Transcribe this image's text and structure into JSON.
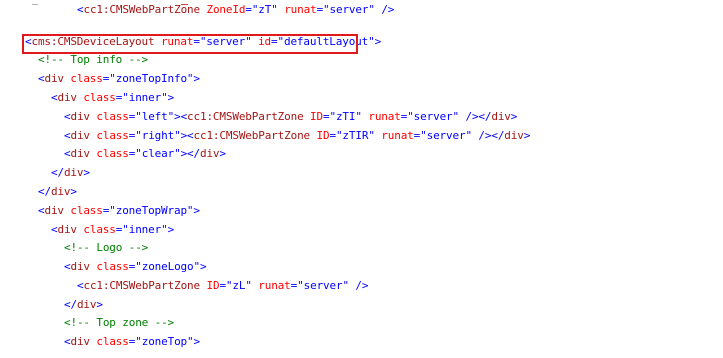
{
  "highlight": {
    "color": "#e0191d"
  },
  "lines": [
    {
      "indent": 0,
      "parts": [
        {
          "k": "p",
          "t": "<"
        },
        {
          "k": "t",
          "t": "cms:CMSDeviceLayout"
        },
        {
          "k": "t",
          "t": " "
        },
        {
          "k": "a",
          "t": "runat"
        },
        {
          "k": "p",
          "t": "="
        },
        {
          "k": "v",
          "t": "\"server\""
        },
        {
          "k": "t",
          "t": " "
        },
        {
          "k": "a",
          "t": "id"
        },
        {
          "k": "p",
          "t": "="
        },
        {
          "k": "v",
          "t": "\"defaultLayout\""
        },
        {
          "k": "p",
          "t": ">"
        }
      ]
    },
    {
      "indent": 2,
      "parts": [
        {
          "k": "c",
          "t": "<!-- Top info -->"
        }
      ]
    },
    {
      "indent": 2,
      "parts": [
        {
          "k": "p",
          "t": "<"
        },
        {
          "k": "t",
          "t": "div"
        },
        {
          "k": "t",
          "t": " "
        },
        {
          "k": "a",
          "t": "class"
        },
        {
          "k": "p",
          "t": "="
        },
        {
          "k": "v",
          "t": "\"zoneTopInfo\""
        },
        {
          "k": "p",
          "t": ">"
        }
      ]
    },
    {
      "indent": 4,
      "parts": [
        {
          "k": "p",
          "t": "<"
        },
        {
          "k": "t",
          "t": "div"
        },
        {
          "k": "t",
          "t": " "
        },
        {
          "k": "a",
          "t": "class"
        },
        {
          "k": "p",
          "t": "="
        },
        {
          "k": "v",
          "t": "\"inner\""
        },
        {
          "k": "p",
          "t": ">"
        }
      ]
    },
    {
      "indent": 6,
      "parts": [
        {
          "k": "p",
          "t": "<"
        },
        {
          "k": "t",
          "t": "div"
        },
        {
          "k": "t",
          "t": " "
        },
        {
          "k": "a",
          "t": "class"
        },
        {
          "k": "p",
          "t": "="
        },
        {
          "k": "v",
          "t": "\"left\""
        },
        {
          "k": "p",
          "t": "><"
        },
        {
          "k": "t",
          "t": "cc1:CMSWebPartZone"
        },
        {
          "k": "t",
          "t": " "
        },
        {
          "k": "a",
          "t": "ID"
        },
        {
          "k": "p",
          "t": "="
        },
        {
          "k": "v",
          "t": "\"zTI\""
        },
        {
          "k": "t",
          "t": " "
        },
        {
          "k": "a",
          "t": "runat"
        },
        {
          "k": "p",
          "t": "="
        },
        {
          "k": "v",
          "t": "\"server\""
        },
        {
          "k": "t",
          "t": " "
        },
        {
          "k": "p",
          "t": "/></"
        },
        {
          "k": "t",
          "t": "div"
        },
        {
          "k": "p",
          "t": ">"
        }
      ]
    },
    {
      "indent": 6,
      "parts": [
        {
          "k": "p",
          "t": "<"
        },
        {
          "k": "t",
          "t": "div"
        },
        {
          "k": "t",
          "t": " "
        },
        {
          "k": "a",
          "t": "class"
        },
        {
          "k": "p",
          "t": "="
        },
        {
          "k": "v",
          "t": "\"right\""
        },
        {
          "k": "p",
          "t": "><"
        },
        {
          "k": "t",
          "t": "cc1:CMSWebPartZone"
        },
        {
          "k": "t",
          "t": " "
        },
        {
          "k": "a",
          "t": "ID"
        },
        {
          "k": "p",
          "t": "="
        },
        {
          "k": "v",
          "t": "\"zTIR\""
        },
        {
          "k": "t",
          "t": " "
        },
        {
          "k": "a",
          "t": "runat"
        },
        {
          "k": "p",
          "t": "="
        },
        {
          "k": "v",
          "t": "\"server\""
        },
        {
          "k": "t",
          "t": " "
        },
        {
          "k": "p",
          "t": "/></"
        },
        {
          "k": "t",
          "t": "div"
        },
        {
          "k": "p",
          "t": ">"
        }
      ]
    },
    {
      "indent": 6,
      "parts": [
        {
          "k": "p",
          "t": "<"
        },
        {
          "k": "t",
          "t": "div"
        },
        {
          "k": "t",
          "t": " "
        },
        {
          "k": "a",
          "t": "class"
        },
        {
          "k": "p",
          "t": "="
        },
        {
          "k": "v",
          "t": "\"clear\""
        },
        {
          "k": "p",
          "t": "></"
        },
        {
          "k": "t",
          "t": "div"
        },
        {
          "k": "p",
          "t": ">"
        }
      ]
    },
    {
      "indent": 4,
      "parts": [
        {
          "k": "p",
          "t": "</"
        },
        {
          "k": "t",
          "t": "div"
        },
        {
          "k": "p",
          "t": ">"
        }
      ]
    },
    {
      "indent": 2,
      "parts": [
        {
          "k": "p",
          "t": "</"
        },
        {
          "k": "t",
          "t": "div"
        },
        {
          "k": "p",
          "t": ">"
        }
      ]
    },
    {
      "indent": 2,
      "parts": [
        {
          "k": "p",
          "t": "<"
        },
        {
          "k": "t",
          "t": "div"
        },
        {
          "k": "t",
          "t": " "
        },
        {
          "k": "a",
          "t": "class"
        },
        {
          "k": "p",
          "t": "="
        },
        {
          "k": "v",
          "t": "\"zoneTopWrap\""
        },
        {
          "k": "p",
          "t": ">"
        }
      ]
    },
    {
      "indent": 4,
      "parts": [
        {
          "k": "p",
          "t": "<"
        },
        {
          "k": "t",
          "t": "div"
        },
        {
          "k": "t",
          "t": " "
        },
        {
          "k": "a",
          "t": "class"
        },
        {
          "k": "p",
          "t": "="
        },
        {
          "k": "v",
          "t": "\"inner\""
        },
        {
          "k": "p",
          "t": ">"
        }
      ]
    },
    {
      "indent": 6,
      "parts": [
        {
          "k": "c",
          "t": "<!-- Logo -->"
        }
      ]
    },
    {
      "indent": 6,
      "parts": [
        {
          "k": "p",
          "t": "<"
        },
        {
          "k": "t",
          "t": "div"
        },
        {
          "k": "t",
          "t": " "
        },
        {
          "k": "a",
          "t": "class"
        },
        {
          "k": "p",
          "t": "="
        },
        {
          "k": "v",
          "t": "\"zoneLogo\""
        },
        {
          "k": "p",
          "t": ">"
        }
      ]
    },
    {
      "indent": 8,
      "parts": [
        {
          "k": "p",
          "t": "<"
        },
        {
          "k": "t",
          "t": "cc1:CMSWebPartZone"
        },
        {
          "k": "t",
          "t": " "
        },
        {
          "k": "a",
          "t": "ID"
        },
        {
          "k": "p",
          "t": "="
        },
        {
          "k": "v",
          "t": "\"zL\""
        },
        {
          "k": "t",
          "t": " "
        },
        {
          "k": "a",
          "t": "runat"
        },
        {
          "k": "p",
          "t": "="
        },
        {
          "k": "v",
          "t": "\"server\""
        },
        {
          "k": "t",
          "t": " "
        },
        {
          "k": "p",
          "t": "/>"
        }
      ]
    },
    {
      "indent": 6,
      "parts": [
        {
          "k": "p",
          "t": "</"
        },
        {
          "k": "t",
          "t": "div"
        },
        {
          "k": "p",
          "t": ">"
        }
      ]
    },
    {
      "indent": 6,
      "parts": [
        {
          "k": "c",
          "t": "<!-- Top zone -->"
        }
      ]
    },
    {
      "indent": 6,
      "parts": [
        {
          "k": "p",
          "t": "<"
        },
        {
          "k": "t",
          "t": "div"
        },
        {
          "k": "t",
          "t": " "
        },
        {
          "k": "a",
          "t": "class"
        },
        {
          "k": "p",
          "t": "="
        },
        {
          "k": "v",
          "t": "\"zoneTop\""
        },
        {
          "k": "p",
          "t": ">"
        }
      ]
    },
    {
      "indent": 8,
      "parts": [
        {
          "k": "p",
          "t": "<"
        },
        {
          "k": "t",
          "t": "cc1:CMSWebPartZone"
        },
        {
          "k": "t",
          "t": " "
        },
        {
          "k": "a",
          "t": "ZoneId"
        },
        {
          "k": "p",
          "t": "="
        },
        {
          "k": "v",
          "t": "\"zT\""
        },
        {
          "k": "t",
          "t": " "
        },
        {
          "k": "a",
          "t": "runat"
        },
        {
          "k": "p",
          "t": "="
        },
        {
          "k": "v",
          "t": "\"server\""
        },
        {
          "k": "t",
          "t": " "
        },
        {
          "k": "p",
          "t": "/>"
        }
      ]
    }
  ]
}
